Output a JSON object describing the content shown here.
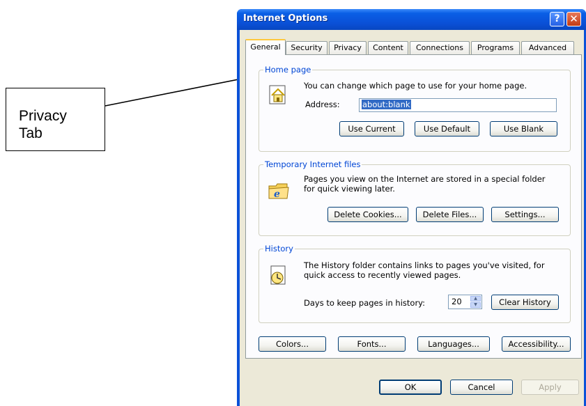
{
  "callout": {
    "text_line1": "Privacy",
    "text_line2": "Tab"
  },
  "window": {
    "title": "Internet Options",
    "help_glyph": "?",
    "close_glyph": "✕"
  },
  "tabs": [
    {
      "label": "General",
      "active": true
    },
    {
      "label": "Security"
    },
    {
      "label": "Privacy"
    },
    {
      "label": "Content"
    },
    {
      "label": "Connections"
    },
    {
      "label": "Programs"
    },
    {
      "label": "Advanced"
    }
  ],
  "home_page": {
    "legend": "Home page",
    "description": "You can change which page to use for your home page.",
    "address_label": "Address:",
    "address_value": "about:blank",
    "use_current": "Use Current",
    "use_default": "Use Default",
    "use_blank": "Use Blank",
    "icon": "house-page-icon"
  },
  "temp_files": {
    "legend": "Temporary Internet files",
    "description_line1": "Pages you view on the Internet are stored in a special folder",
    "description_line2": "for quick viewing later.",
    "delete_cookies": "Delete Cookies...",
    "delete_files": "Delete Files...",
    "settings": "Settings...",
    "icon": "ie-folder-icon"
  },
  "history": {
    "legend": "History",
    "description_line1": "The History folder contains links to pages you've visited, for",
    "description_line2": "quick access to recently viewed pages.",
    "days_label": "Days to keep pages in history:",
    "days_value": "20",
    "clear_history": "Clear History",
    "icon": "history-clock-icon"
  },
  "bottom_buttons": {
    "colors": "Colors...",
    "fonts": "Fonts...",
    "languages": "Languages...",
    "accessibility": "Accessibility..."
  },
  "dialog_buttons": {
    "ok": "OK",
    "cancel": "Cancel",
    "apply": "Apply"
  },
  "colors": {
    "titlebar": "#0a51d8",
    "dialog_bg": "#ece9d8",
    "legend_blue": "#0046d5",
    "active_tab_accent": "#ffc83c"
  }
}
